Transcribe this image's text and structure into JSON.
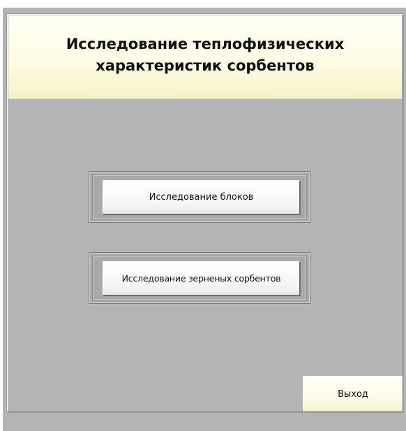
{
  "header": {
    "title_line1": "Исследование теплофизических",
    "title_line2": "характеристик сорбентов"
  },
  "buttons": {
    "blocks_label": "Исследование блоков",
    "granular_label": "Исследование зерненых сорбентов",
    "exit_label": "Выход"
  },
  "colors": {
    "background": "#b4b4b4",
    "header": "#fdfbe2",
    "button": "#f6f6f6"
  }
}
